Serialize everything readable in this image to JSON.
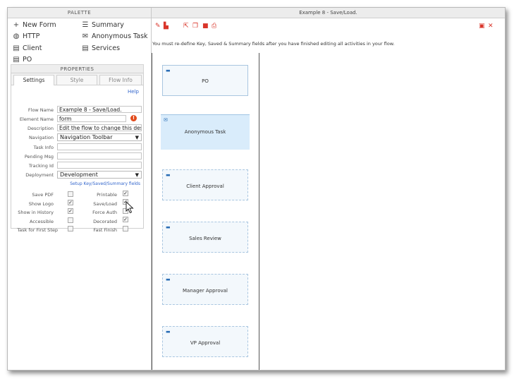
{
  "palette": {
    "header": "PALETTE",
    "items_left": [
      {
        "label": "New Form",
        "icon": "plus-icon",
        "glyph": "+"
      },
      {
        "label": "HTTP",
        "icon": "globe-icon",
        "glyph": "◍"
      },
      {
        "label": "Client",
        "icon": "form-icon",
        "glyph": "▤"
      },
      {
        "label": "PO",
        "icon": "form-icon",
        "glyph": "▤"
      }
    ],
    "items_right": [
      {
        "label": "Summary",
        "icon": "list-icon",
        "glyph": "☰"
      },
      {
        "label": "Anonymous Task",
        "icon": "envelope-icon",
        "glyph": "✉"
      },
      {
        "label": "Services",
        "icon": "form-icon",
        "glyph": "▤"
      }
    ]
  },
  "properties": {
    "header": "PROPERTIES",
    "tabs": [
      "Settings",
      "Style",
      "Flow Info"
    ],
    "help": "Help",
    "fields": {
      "flow_name": {
        "label": "Flow Name",
        "value": "Example 8 - Save/Load."
      },
      "element_name": {
        "label": "Element Name",
        "value": "form"
      },
      "description": {
        "label": "Description",
        "value": "Edit the flow to change this descrip"
      },
      "navigation": {
        "label": "Navigation",
        "value": "Navigation Toolbar"
      },
      "task_info": {
        "label": "Task Info",
        "value": ""
      },
      "pending_msg": {
        "label": "Pending Msg",
        "value": ""
      },
      "tracking_id": {
        "label": "Tracking Id",
        "value": ""
      },
      "deployment": {
        "label": "Deployment",
        "value": "Development"
      }
    },
    "setup_link": "Setup Key/Saved/Summary fields",
    "checkboxes_left": [
      {
        "label": "Save PDF",
        "checked": false
      },
      {
        "label": "Show Logo",
        "checked": true
      },
      {
        "label": "Show in History",
        "checked": true
      },
      {
        "label": "Accessible",
        "checked": false
      },
      {
        "label": "Task for First Step",
        "checked": false
      }
    ],
    "checkboxes_right": [
      {
        "label": "Printable",
        "checked": true
      },
      {
        "label": "Save/Load",
        "checked": true
      },
      {
        "label": "Force Auth",
        "checked": false
      },
      {
        "label": "Decorated",
        "checked": true
      },
      {
        "label": "Fast Finish",
        "checked": false
      }
    ]
  },
  "canvas": {
    "title": "Example 8 - Save/Load.",
    "notice": "You must re-define Key, Saved & Summary fields after you have finished editing all activities in your flow.",
    "nodes": [
      {
        "label": "PO",
        "type": "form"
      },
      {
        "label": "Anonymous Task",
        "type": "envelope"
      },
      {
        "label": "Client Approval",
        "type": "form"
      },
      {
        "label": "Sales Review",
        "type": "form"
      },
      {
        "label": "Manager Approval",
        "type": "form"
      },
      {
        "label": "VP Approval",
        "type": "form"
      }
    ]
  },
  "colors": {
    "accent": "#d9352a",
    "link": "#3366cc",
    "selected_node": "#d9ecfb"
  }
}
